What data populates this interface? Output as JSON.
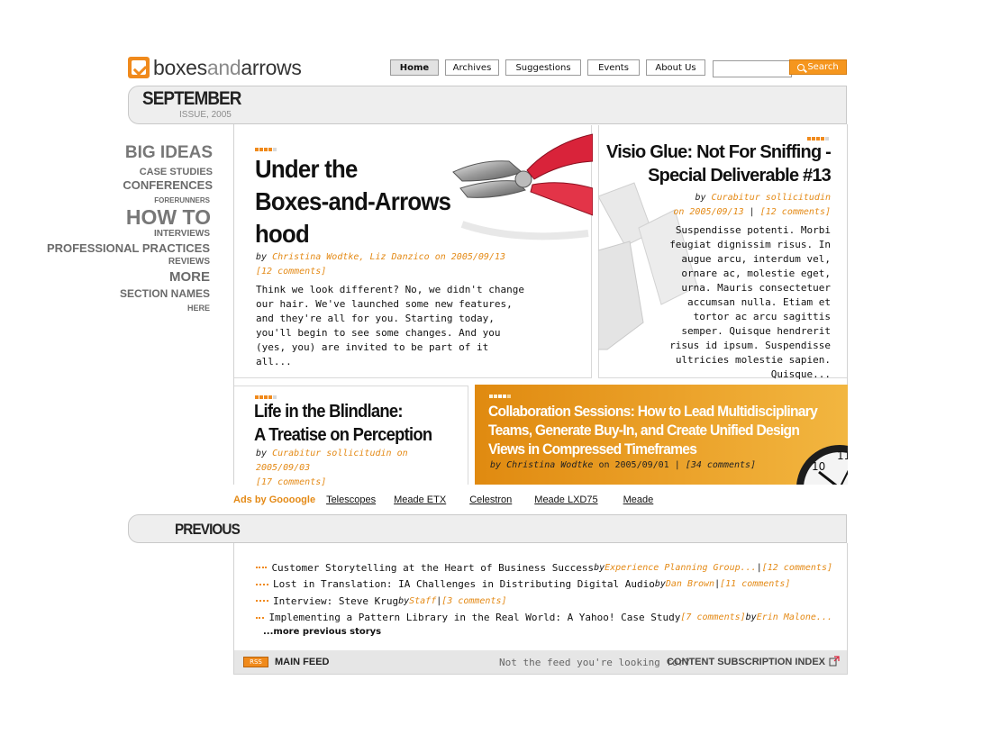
{
  "brand": {
    "logo_part1": "boxes",
    "logo_part2": "and",
    "logo_part3": "arrows",
    "accent_color": "#f08a1c"
  },
  "nav": {
    "items": [
      "Home",
      "Archives",
      "Suggestions",
      "Events",
      "About Us"
    ],
    "active": "Home",
    "search_button": "Search",
    "search_placeholder": ""
  },
  "issue": {
    "month": "SEPTEMBER",
    "subtitle": "ISSUE, 2005"
  },
  "sidebar": {
    "items": [
      {
        "label": "BIG IDEAS",
        "size": "xl"
      },
      {
        "label": "CASE STUDIES",
        "size": "s"
      },
      {
        "label": "CONFERENCES",
        "size": "m"
      },
      {
        "label": "FORERUNNERS",
        "size": "xs"
      },
      {
        "label": "HOW TO",
        "size": "xxl"
      },
      {
        "label": "INTERVIEWS",
        "size": "s"
      },
      {
        "label": "PROFESSIONAL PRACTICES",
        "size": "m"
      },
      {
        "label": "REVIEWS",
        "size": "s"
      },
      {
        "label": "MORE",
        "size": "l"
      },
      {
        "label": "SECTION NAMES",
        "size": "m"
      },
      {
        "label": "HERE",
        "size": "xs"
      }
    ]
  },
  "features": {
    "f1": {
      "title_lines": [
        "Under the",
        "Boxes-and-Arrows",
        "hood"
      ],
      "by": "by",
      "authors": "Christina Wodtke, Liz Danzico",
      "on": "on 2005/09/13",
      "comments": "[12 comments]",
      "body": "Think we look different? No, we didn't change our hair. We've launched some new features, and they're all for you. Starting today, you'll begin to see some changes. And you (yes, you) are invited to be part of it all..."
    },
    "f2": {
      "title_lines": [
        "Visio Glue: Not For Sniffing -",
        "Special Deliverable #13"
      ],
      "by": "by",
      "authors": "Curabitur sollicitudin",
      "on": "on 2005/09/13",
      "sep": "|",
      "comments": "[12 comments]",
      "body": "Suspendisse potenti. Morbi feugiat dignissim risus. In augue arcu, interdum vel, ornare ac, molestie eget, urna. Mauris consectetuer accumsan nulla. Etiam et tortor ac arcu sagittis semper. Quisque hendrerit risus id ipsum. Suspendisse ultricies molestie sapien. Quisque..."
    },
    "f3": {
      "title_lines": [
        "Life in the Blindlane:",
        "A Treatise on Perception"
      ],
      "by": "by",
      "authors": "Curabitur sollicitudin",
      "on": "on 2005/09/03",
      "comments": "[17 comments]"
    },
    "f4": {
      "title_lines": [
        "Collaboration Sessions: How to Lead Multidisciplinary",
        "Teams, Generate Buy-In, and Create Unified Design",
        "Views in Compressed Timeframes"
      ],
      "by": "by",
      "authors": "Christina Wodtke",
      "on": "on 2005/09/01",
      "sep": "|",
      "comments": "[34 comments]"
    }
  },
  "ads": {
    "label": "Ads by Goooogle",
    "links": [
      "Telescopes",
      "Meade ETX",
      "Celestron",
      "Meade LXD75",
      "Meade"
    ]
  },
  "previous": {
    "heading": "PREVIOUS",
    "items": [
      {
        "title": "Customer Storytelling at the Heart of Business Success",
        "meta": [
          {
            "t": "by",
            "c": "k"
          },
          {
            "t": "Experience Planning Group...",
            "c": "o"
          },
          {
            "t": "|",
            "c": "k"
          },
          {
            "t": "[12 comments]",
            "c": "o"
          }
        ]
      },
      {
        "title": "Lost in Translation: IA Challenges in Distributing Digital Audio",
        "meta": [
          {
            "t": "by",
            "c": "k"
          },
          {
            "t": "Dan Brown",
            "c": "o"
          },
          {
            "t": "|",
            "c": "k"
          },
          {
            "t": "[11 comments]",
            "c": "o"
          }
        ]
      },
      {
        "title": "Interview: Steve Krug",
        "meta": [
          {
            "t": "by",
            "c": "k"
          },
          {
            "t": "Staff",
            "c": "o"
          },
          {
            "t": "|",
            "c": "k"
          },
          {
            "t": "[3 comments]",
            "c": "o"
          }
        ]
      },
      {
        "title": "Implementing a Pattern Library in the Real World: A Yahoo! Case Study",
        "meta": [
          {
            "t": "[7 comments]",
            "c": "o"
          },
          {
            "t": "by",
            "c": "k"
          },
          {
            "t": "Erin Malone...",
            "c": "o"
          }
        ]
      }
    ],
    "more": "...more previous storys"
  },
  "feed": {
    "rss_label": "RSS",
    "main_feed": "MAIN FEED",
    "question": "Not the feed you're looking for?",
    "index_link": "CONTENT SUBSCRIPTION INDEX"
  }
}
